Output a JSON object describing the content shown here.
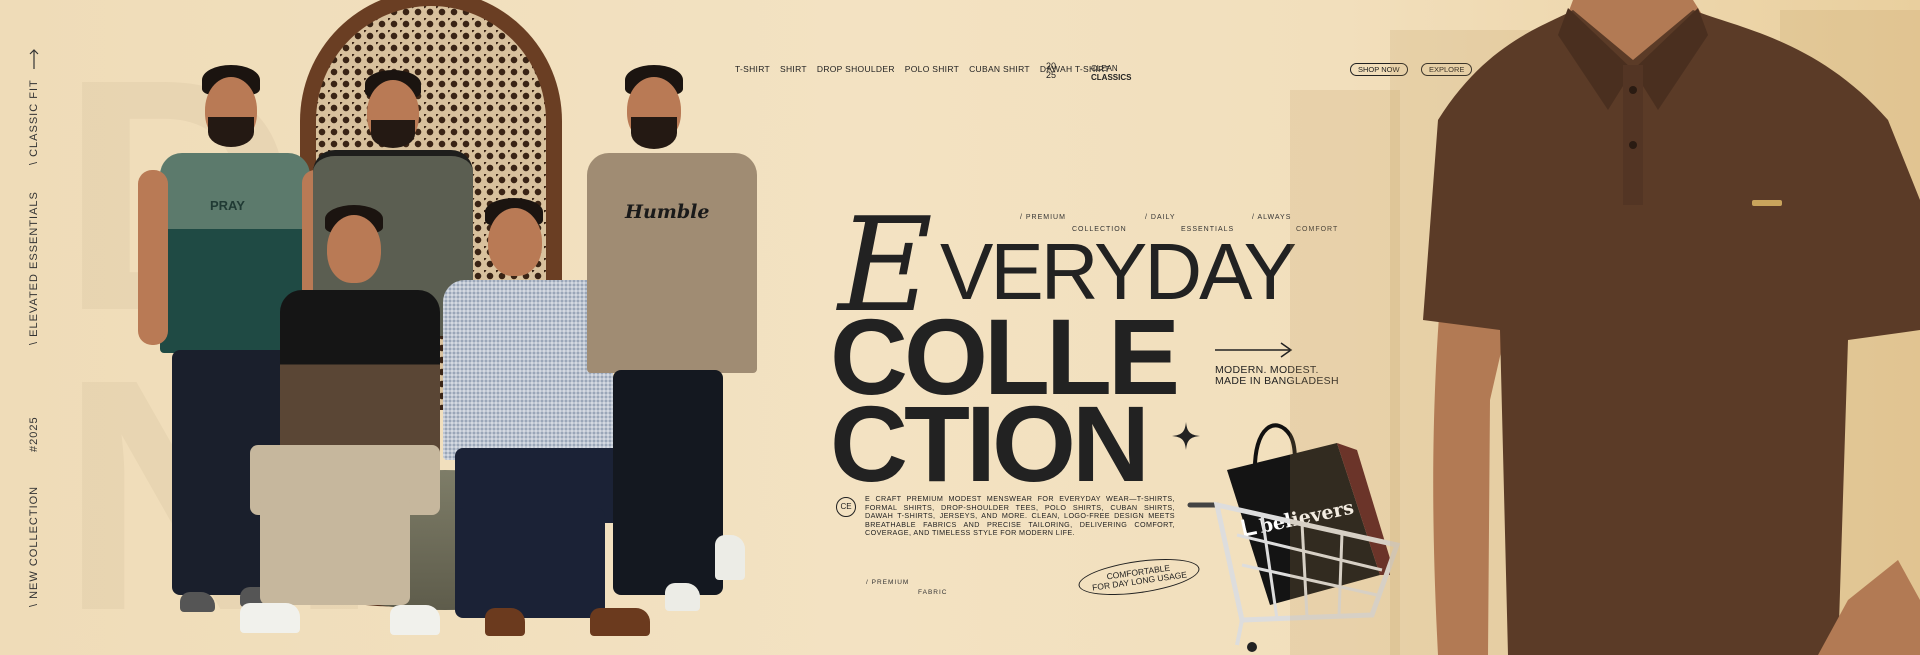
{
  "nav": {
    "items": [
      "T-SHIRT",
      "SHIRT",
      "DROP SHOULDER",
      "POLO SHIRT",
      "CUBAN SHIRT",
      "DAWAH T-SHIRT"
    ],
    "year_top": "20",
    "year_bottom": "25",
    "clean_top": "CLEAN",
    "clean_bottom": "CLASSICS",
    "shop_now": "SHOP NOW",
    "explore": "EXPLORE"
  },
  "side": {
    "classic_fit": "\\ CLASSIC FIT",
    "elevated": "\\ ELEVATED ESSENTIALS",
    "hashtag": "#2025",
    "new_collection": "\\ NEW COLLECTION"
  },
  "tags": {
    "t1a": "/ PREMIUM",
    "t1b": "COLLECTION",
    "t2a": "/ DAILY",
    "t2b": "ESSENTIALS",
    "t3a": "/ ALWAYS",
    "t3b": "COMFORT"
  },
  "headline": {
    "e": "E",
    "very": "VERYDAY",
    "line2": "COLLE",
    "line3": "CTION"
  },
  "modern": {
    "line1": "MODERN. MODEST.",
    "line2": "MADE IN BANGLADESH"
  },
  "desc": "E CRAFT PREMIUM MODEST MENSWEAR FOR EVERYDAY WEAR—T-SHIRTS, FORMAL SHIRTS, DROP-SHOULDER TEES, POLO SHIRTS, CUBAN SHIRTS, DAWAH T-SHIRTS, JERSEYS, AND MORE. CLEAN, LOGO-FREE DESIGN MEETS BREATHABLE FABRICS AND PRECISE TAILORING, DELIVERING COMFORT, COVERAGE, AND TIMELESS STYLE FOR MODERN LIFE.",
  "ce": "CE",
  "bottom_tag": {
    "a": "/ PREMIUM",
    "b": "FABRIC"
  },
  "comfort": {
    "line1": "COMFORTABLE",
    "line2": "FOR DAY LONG USAGE"
  },
  "brand": "believers",
  "shirt_prints": {
    "pray": "PRAY",
    "humble": "Humble"
  },
  "colors": {
    "background": "#f1dfbc",
    "text": "#222222",
    "polo_brown": "#5b3b27",
    "teal": "#1f4a44",
    "sage": "#5c7a6c"
  }
}
